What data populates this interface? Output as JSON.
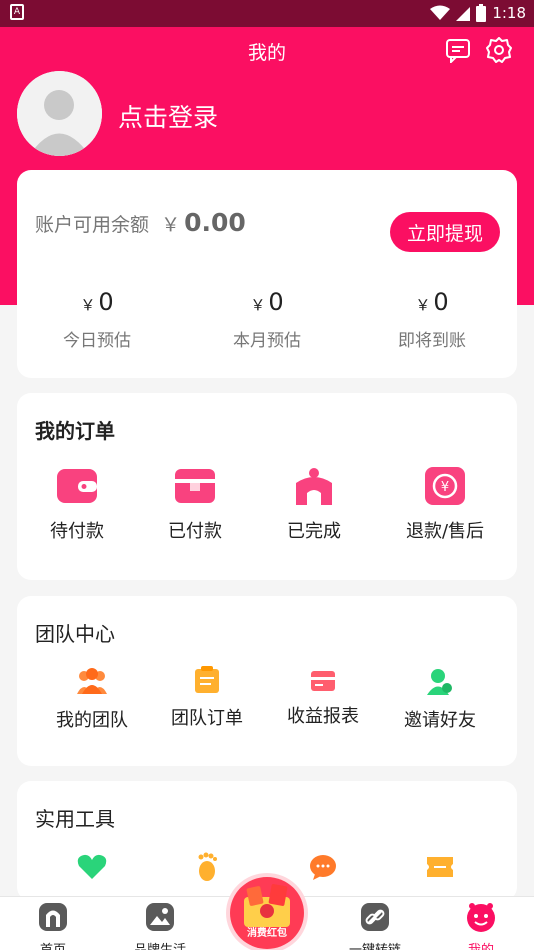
{
  "status_bar": {
    "time": "1:18"
  },
  "header": {
    "title": "我的",
    "login_text": "点击登录"
  },
  "account": {
    "label": "账户可用余额",
    "currency": "￥",
    "amount": "0.00",
    "withdraw_label": "立即提现",
    "stats": [
      {
        "currency": "￥",
        "value": "0",
        "label": "今日预估"
      },
      {
        "currency": "￥",
        "value": "0",
        "label": "本月预估"
      },
      {
        "currency": "￥",
        "value": "0",
        "label": "即将到账"
      }
    ]
  },
  "orders": {
    "title": "我的订单",
    "items": [
      {
        "label": "待付款",
        "icon": "wallet-icon"
      },
      {
        "label": "已付款",
        "icon": "box-icon"
      },
      {
        "label": "已完成",
        "icon": "shop-icon"
      },
      {
        "label": "退款/售后",
        "icon": "refund-icon"
      }
    ]
  },
  "team": {
    "title": "团队中心",
    "items": [
      {
        "label": "我的团队",
        "icon": "team-icon"
      },
      {
        "label": "团队订单",
        "icon": "clipboard-icon"
      },
      {
        "label": "收益报表",
        "icon": "card-icon"
      },
      {
        "label": "邀请好友",
        "icon": "invite-icon"
      }
    ]
  },
  "tools": {
    "title": "实用工具",
    "items": [
      {
        "icon": "heart-icon"
      },
      {
        "icon": "footprint-icon"
      },
      {
        "icon": "chat-icon"
      },
      {
        "icon": "ticket-icon"
      }
    ]
  },
  "tabbar": {
    "items": [
      {
        "label": "首页",
        "icon": "home-icon"
      },
      {
        "label": "品牌生活",
        "icon": "image-icon"
      },
      {
        "label": "消费红包",
        "icon": "red-packet-icon"
      },
      {
        "label": "一键转链",
        "icon": "link-icon"
      },
      {
        "label": "我的",
        "icon": "profile-face-icon"
      }
    ],
    "active_color": "#fb0f62"
  },
  "colors": {
    "brand": "#fb0f62",
    "statusbar": "#7c0c33",
    "accent_orange": "#ff8a3d",
    "accent_green": "#2ad47a"
  }
}
